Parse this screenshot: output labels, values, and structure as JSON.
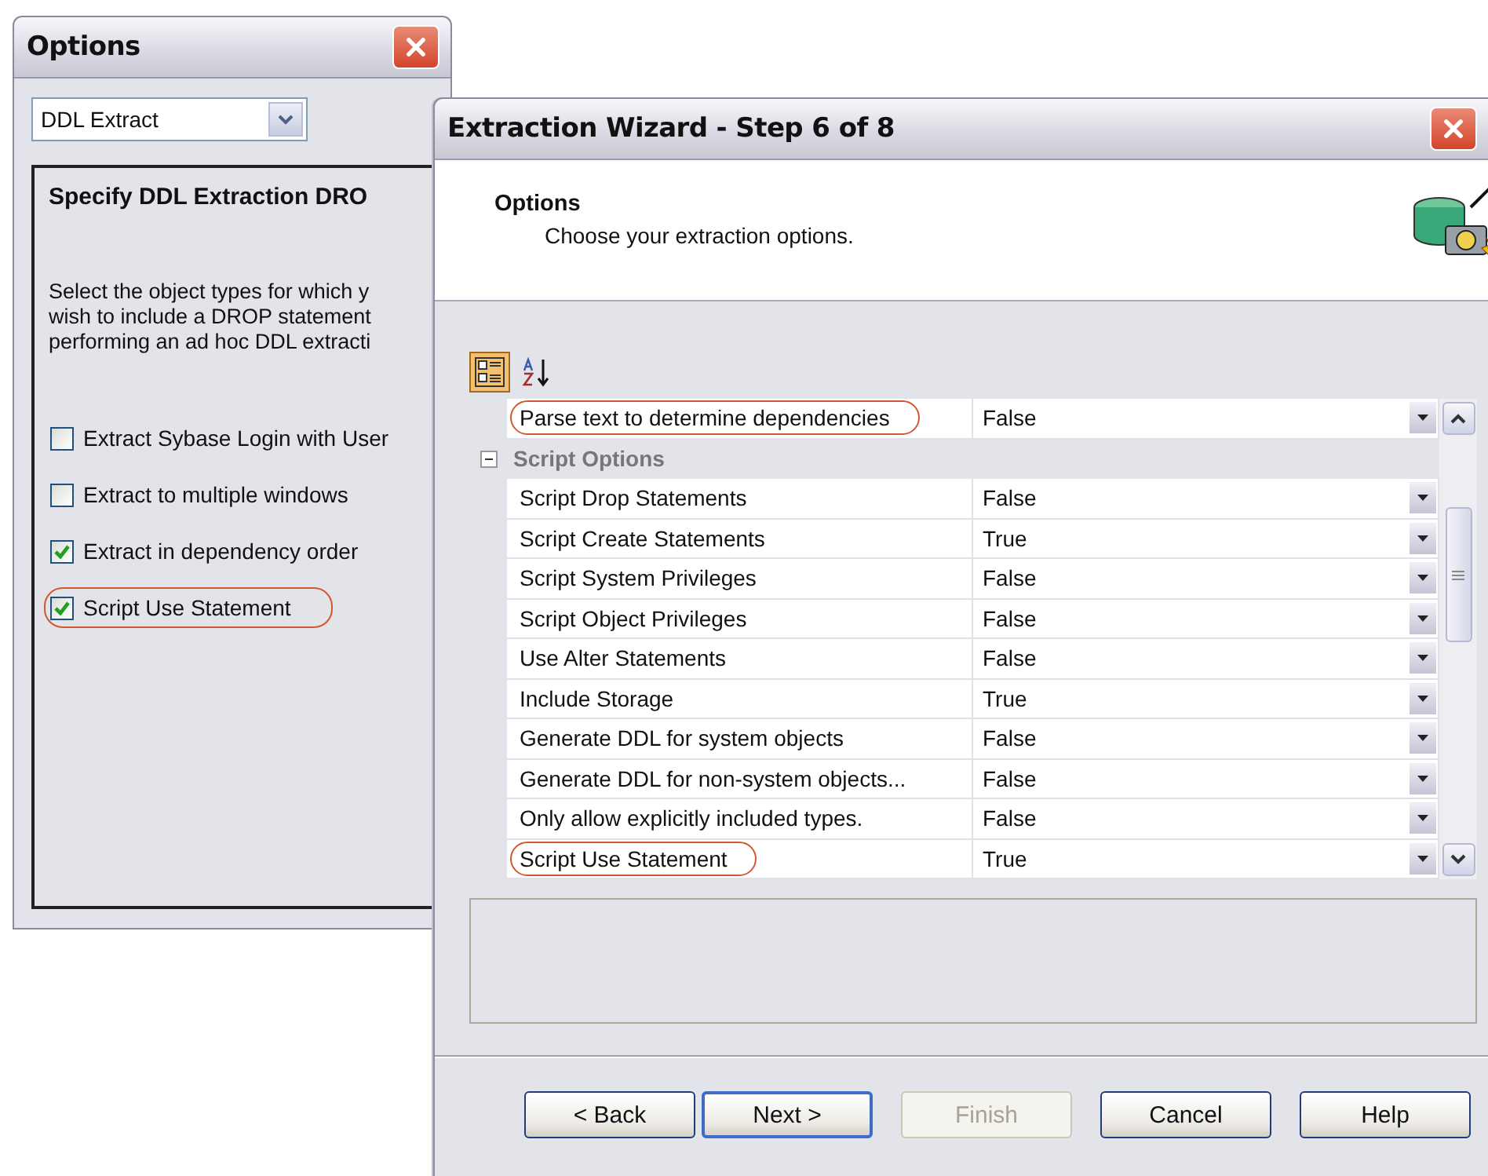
{
  "options_window": {
    "title": "Options",
    "dropdown": {
      "value": "DDL Extract"
    },
    "panel": {
      "heading": "Specify DDL Extraction DRO",
      "description": "Select the object types for which y\nwish to include a DROP statement\nperforming an ad hoc DDL extracti",
      "checkboxes": [
        {
          "label": "Extract Sybase Login with User",
          "checked": false,
          "highlighted": false
        },
        {
          "label": "Extract to multiple windows",
          "checked": false,
          "highlighted": false
        },
        {
          "label": "Extract in dependency order",
          "checked": true,
          "highlighted": false
        },
        {
          "label": "Script Use Statement",
          "checked": true,
          "highlighted": true
        }
      ]
    }
  },
  "wizard": {
    "title": "Extraction Wizard - Step 6 of 8",
    "header": {
      "title": "Options",
      "subtitle": "Choose your extraction options."
    },
    "toolbar": [
      {
        "kind": "categorized",
        "selected": true
      },
      {
        "kind": "alphabetical",
        "selected": false
      }
    ],
    "properties": [
      {
        "kind": "property",
        "name": "Parse text to determine dependencies",
        "value": "False",
        "highlighted": true
      },
      {
        "kind": "category",
        "name": "Script Options",
        "expanded": true,
        "children": [
          {
            "kind": "property",
            "name": "Script Drop Statements",
            "value": "False",
            "highlighted": false
          },
          {
            "kind": "property",
            "name": "Script Create Statements",
            "value": "True",
            "highlighted": false
          },
          {
            "kind": "property",
            "name": "Script System Privileges",
            "value": "False",
            "highlighted": false
          },
          {
            "kind": "property",
            "name": "Script Object Privileges",
            "value": "False",
            "highlighted": false
          },
          {
            "kind": "property",
            "name": "Use Alter Statements",
            "value": "False",
            "highlighted": false
          },
          {
            "kind": "property",
            "name": "Include Storage",
            "value": "True",
            "highlighted": false
          },
          {
            "kind": "property",
            "name": "Generate DDL for system objects",
            "value": "False",
            "highlighted": false
          },
          {
            "kind": "property",
            "name": "Generate DDL for non-system objects...",
            "value": "False",
            "highlighted": false
          },
          {
            "kind": "property",
            "name": "Only allow explicitly included types.",
            "value": "False",
            "highlighted": false
          },
          {
            "kind": "property",
            "name": "Script Use Statement",
            "value": "True",
            "highlighted": true
          }
        ]
      }
    ],
    "buttons": [
      {
        "label": "< Back",
        "disabled": false,
        "default": false
      },
      {
        "label": "Next >",
        "disabled": false,
        "default": true
      },
      {
        "label": "Finish",
        "disabled": true,
        "default": false
      },
      {
        "label": "Cancel",
        "disabled": false,
        "default": false
      },
      {
        "label": "Help",
        "disabled": false,
        "default": false
      }
    ]
  }
}
